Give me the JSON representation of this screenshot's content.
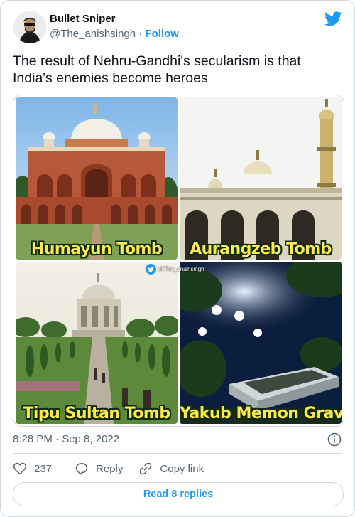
{
  "author": {
    "name": "Bullet Sniper",
    "handle": "@The_anishsingh",
    "separator": "·",
    "follow_label": "Follow"
  },
  "tweet": {
    "text": "The result of Nehru-Gandhi's secularism is that India's enemies become heroes"
  },
  "media": {
    "tiles": [
      {
        "caption": "Humayun Tomb"
      },
      {
        "caption": "Aurangzeb Tomb"
      },
      {
        "caption": "Tipu Sultan Tomb"
      },
      {
        "caption": "Yakub Memon Grave"
      }
    ],
    "watermark": "@The_anishsingh"
  },
  "meta": {
    "timestamp": "8:28 PM · Sep 8, 2022"
  },
  "actions": {
    "like_count": "237",
    "reply_label": "Reply",
    "copy_link_label": "Copy link",
    "read_replies_label": "Read 8 replies"
  },
  "colors": {
    "accent": "#1d9bf0",
    "secondary_text": "#536471",
    "border": "#cfd9de",
    "caption_yellow": "#ffe94a"
  },
  "icons": [
    "twitter-bird-icon",
    "info-icon",
    "heart-icon",
    "reply-bubble-icon",
    "link-icon"
  ]
}
